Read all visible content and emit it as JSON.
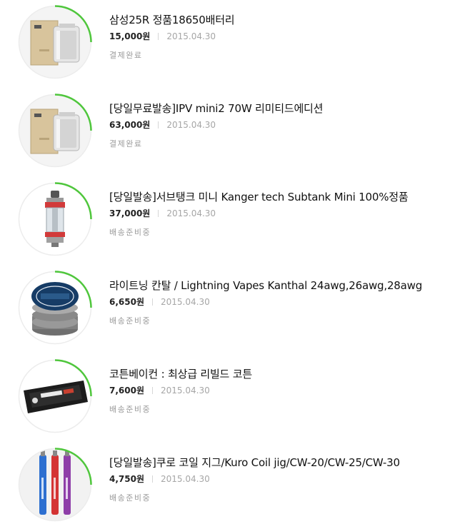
{
  "orders": [
    {
      "title": "삼성25R 정품18650배터리",
      "price": "15,000원",
      "date": "2015.04.30",
      "status": "결제완료",
      "thumb_icon": "vape-box-mod-icon",
      "progress": 0.25
    },
    {
      "title": "[당일무료발송]IPV mini2 70W 리미티드에디션",
      "price": "63,000원",
      "date": "2015.04.30",
      "status": "결제완료",
      "thumb_icon": "vape-box-mod-icon",
      "progress": 0.25
    },
    {
      "title": "[당일발송]서브탱크 미니 Kanger tech Subtank Mini 100%정품",
      "price": "37,000원",
      "date": "2015.04.30",
      "status": "배송준비중",
      "thumb_icon": "tank-atomizer-icon",
      "progress": 0.25
    },
    {
      "title": "라이트닝 칸탈 / Lightning Vapes Kanthal 24awg,26awg,28awg",
      "price": "6,650원",
      "date": "2015.04.30",
      "status": "배송준비중",
      "thumb_icon": "wire-spool-icon",
      "progress": 0.25
    },
    {
      "title": "코튼베이컨 : 최상급 리빌드 코튼",
      "price": "7,600원",
      "date": "2015.04.30",
      "status": "배송준비중",
      "thumb_icon": "cotton-pack-icon",
      "progress": 0.25
    },
    {
      "title": "[당일발송]쿠로 코일 지그/Kuro Coil jig/CW-20/CW-25/CW-30",
      "price": "4,750원",
      "date": "2015.04.30",
      "status": "배송준비중",
      "thumb_icon": "coil-jig-icon",
      "progress": 0.25
    }
  ],
  "colors": {
    "accent": "#4fc63c",
    "ring_bg": "#ececec"
  }
}
